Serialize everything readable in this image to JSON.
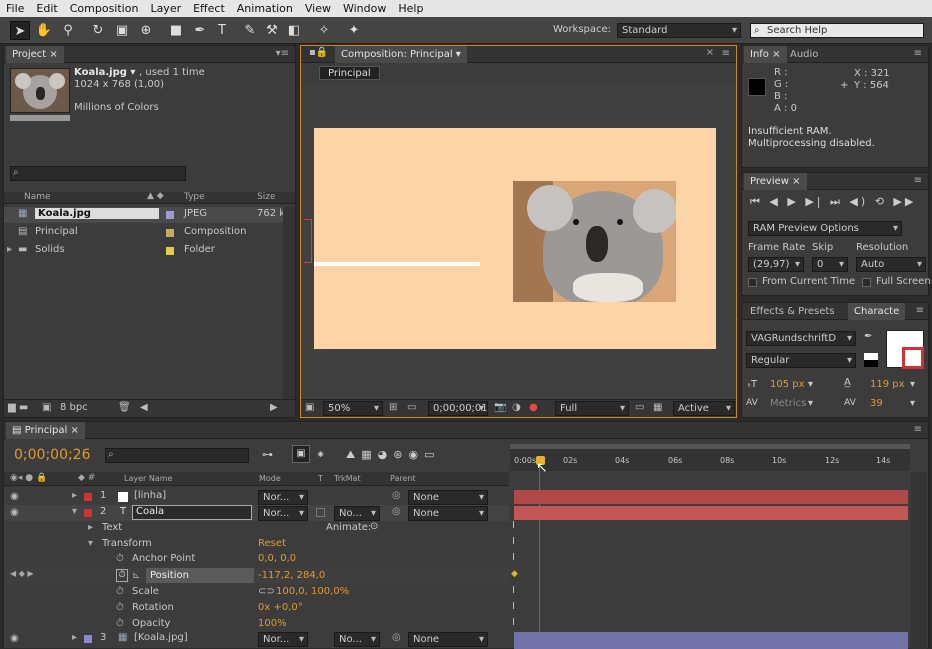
{
  "menu": [
    "File",
    "Edit",
    "Composition",
    "Layer",
    "Effect",
    "Animation",
    "View",
    "Window",
    "Help"
  ],
  "toolbar": {
    "workspace_label": "Workspace:",
    "workspace_value": "Standard",
    "search_placeholder": "Search Help"
  },
  "project": {
    "tab": "Project",
    "item_name": "Koala.jpg ▾",
    "used": ", used 1 time",
    "dimensions": "1024 x 768 (1,00)",
    "colors": "Millions of Colors",
    "columns": {
      "name": "Name",
      "type": "Type",
      "size": "Size"
    },
    "items": [
      {
        "name": "Koala.jpg",
        "type": "JPEG",
        "size": "762 k",
        "label_color": "#9b9bd8"
      },
      {
        "name": "Principal",
        "type": "Composition",
        "size": "",
        "label_color": "#c8a865"
      },
      {
        "name": "Solids",
        "type": "Folder",
        "size": "",
        "label_color": "#e6c84a"
      }
    ],
    "bpc": "8 bpc"
  },
  "composition": {
    "tab": "Composition: Principal",
    "subtab": "Principal",
    "zoom": "50%",
    "timecode": "0;00;00;01",
    "resolution": "Full",
    "camera": "Active Came"
  },
  "info": {
    "tab": "Info",
    "tab2": "Audio",
    "r": "R :",
    "g": "G :",
    "b": "B :",
    "a": "A : 0",
    "x": "X : 321",
    "y": "Y : 564",
    "msg1": "Insufficient RAM.",
    "msg2": "Multiprocessing disabled."
  },
  "preview": {
    "tab": "Preview",
    "ram_options": "RAM Preview Options",
    "frame_rate_label": "Frame Rate",
    "skip_label": "Skip",
    "resolution_label": "Resolution",
    "frame_rate": "(29,97)",
    "skip": "0",
    "resolution": "Auto",
    "from_current": "From Current Time",
    "full_screen": "Full Screen"
  },
  "character": {
    "tab1": "Effects & Presets",
    "tab2": "Characte",
    "font": "VAGRundschriftD",
    "style": "Regular",
    "size": "105 px",
    "leading": "119 px",
    "kerning": "Metrics",
    "tracking": "39"
  },
  "timeline": {
    "tab": "Principal",
    "timecode": "0;00;00;26",
    "ruler": [
      "0:00s",
      "02s",
      "04s",
      "06s",
      "08s",
      "10s",
      "12s",
      "14s"
    ],
    "columns": {
      "layer_name": "Layer Name",
      "mode": "Mode",
      "t": "T",
      "trkmat": "TrkMat",
      "parent": "Parent"
    },
    "layers": [
      {
        "num": "1",
        "name": "[linha]",
        "mode": "Nor...",
        "trk": "",
        "parent": "None",
        "color": "#c33"
      },
      {
        "num": "2",
        "name": "Coala",
        "mode": "Nor...",
        "trk": "No...",
        "parent": "None",
        "color": "#c33"
      }
    ],
    "layer3": {
      "num": "3",
      "name": "[Koala.jpg]",
      "mode": "Nor...",
      "trk": "No...",
      "parent": "None"
    },
    "props": {
      "text": "Text",
      "animate": "Animate:",
      "transform": "Transform",
      "reset": "Reset",
      "anchor": "Anchor Point",
      "anchor_val": "0,0, 0,0",
      "position": "Position",
      "position_val": "-117,2, 284,0",
      "scale": "Scale",
      "scale_val": "100,0, 100,0%",
      "rotation": "Rotation",
      "rotation_val": "0x +0,0°",
      "opacity": "Opacity",
      "opacity_val": "100%"
    }
  }
}
